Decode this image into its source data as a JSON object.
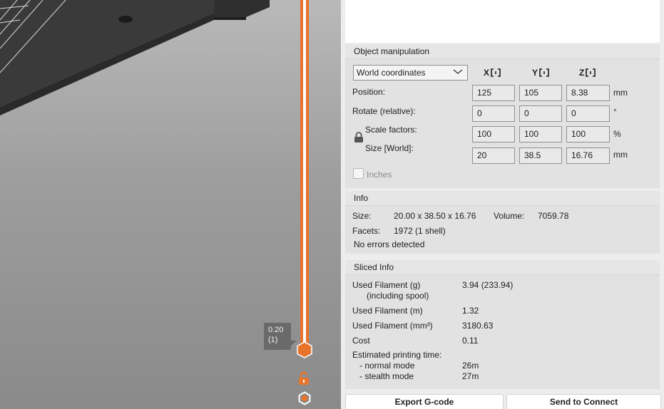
{
  "viewport": {
    "layer_label_height": "0.20",
    "layer_label_index": "(1)"
  },
  "object_manipulation": {
    "title": "Object manipulation",
    "coordinate_system": "World coordinates",
    "axes": [
      "X",
      "Y",
      "Z"
    ],
    "position": {
      "label": "Position:",
      "x": "125",
      "y": "105",
      "z": "8.38",
      "unit": "mm"
    },
    "rotate": {
      "label": "Rotate (relative):",
      "x": "0",
      "y": "0",
      "z": "0",
      "unit": "°"
    },
    "scale": {
      "label": "Scale factors:",
      "x": "100",
      "y": "100",
      "z": "100",
      "unit": "%"
    },
    "size": {
      "label": "Size [World]:",
      "x": "20",
      "y": "38.5",
      "z": "16.76",
      "unit": "mm"
    },
    "inches_label": "Inches",
    "inches_checked": false
  },
  "info": {
    "title": "Info",
    "size_label": "Size:",
    "size_value": "20.00 x 38.50 x 16.76",
    "volume_label": "Volume:",
    "volume_value": "7059.78",
    "facets_label": "Facets:",
    "facets_value": "1972 (1 shell)",
    "status": "No errors detected"
  },
  "sliced_info": {
    "title": "Sliced Info",
    "filament_g_label": "Used Filament (g)",
    "filament_g_sublabel": "(including spool)",
    "filament_g_value": "3.94 (233.94)",
    "filament_m_label": "Used Filament (m)",
    "filament_m_value": "1.32",
    "filament_mm3_label": "Used Filament (mm³)",
    "filament_mm3_value": "3180.63",
    "cost_label": "Cost",
    "cost_value": "0.11",
    "print_time_label": "Estimated printing time:",
    "normal_mode_label": "- normal mode",
    "normal_mode_value": "26m",
    "stealth_mode_label": "- stealth mode",
    "stealth_mode_value": "27m"
  },
  "buttons": {
    "export_gcode": "Export G-code",
    "send_to_connect": "Send to Connect"
  },
  "colors": {
    "accent": "#e8742c"
  }
}
